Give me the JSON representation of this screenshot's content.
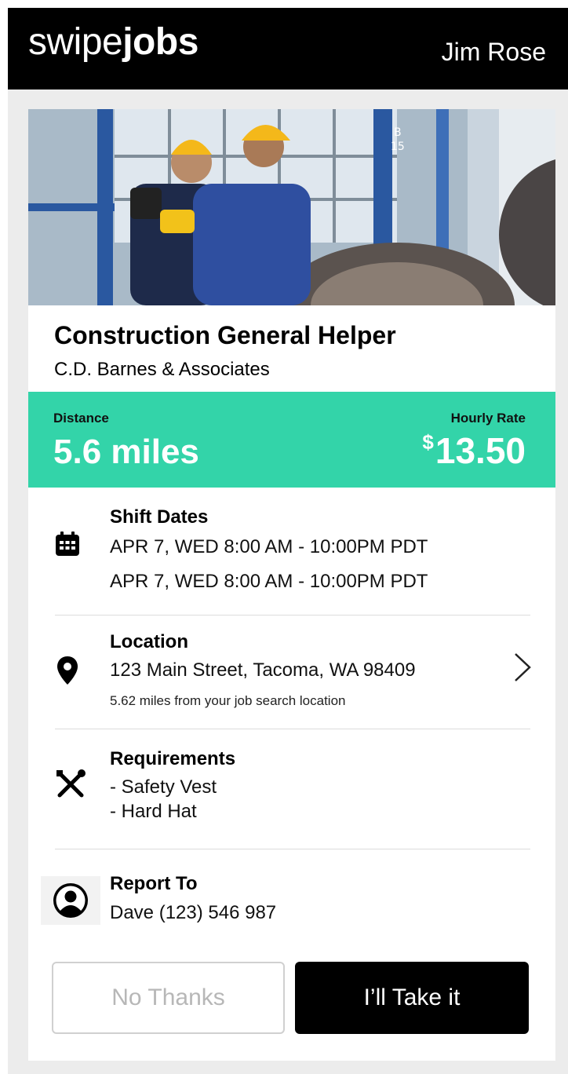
{
  "header": {
    "brand_light": "swipe",
    "brand_bold": "jobs",
    "user_name": "Jim Rose"
  },
  "job": {
    "title": "Construction General Helper",
    "company": "C.D. Barnes & Associates",
    "hero_image_icon": "workers-photo"
  },
  "pay": {
    "distance_label": "Distance",
    "distance_value": "5.6 miles",
    "rate_label": "Hourly Rate",
    "rate_currency": "$",
    "rate_value": "13.50",
    "accent_color": "#33d4a9"
  },
  "shift": {
    "icon": "calendar-icon",
    "title": "Shift Dates",
    "lines": [
      "APR 7, WED 8:00 AM - 10:00PM PDT",
      "APR 7, WED 8:00 AM - 10:00PM PDT"
    ]
  },
  "location": {
    "icon": "map-pin-icon",
    "title": "Location",
    "address": "123 Main Street, Tacoma, WA 98409",
    "distance_note": "5.62 miles from your job search location"
  },
  "requirements": {
    "icon": "tools-icon",
    "title": "Requirements",
    "items": [
      "- Safety Vest",
      "- Hard Hat"
    ]
  },
  "report": {
    "icon": "person-icon",
    "title": "Report To",
    "contact": "Dave (123) 546 987"
  },
  "actions": {
    "decline": "No Thanks",
    "accept": "I’ll Take it"
  }
}
